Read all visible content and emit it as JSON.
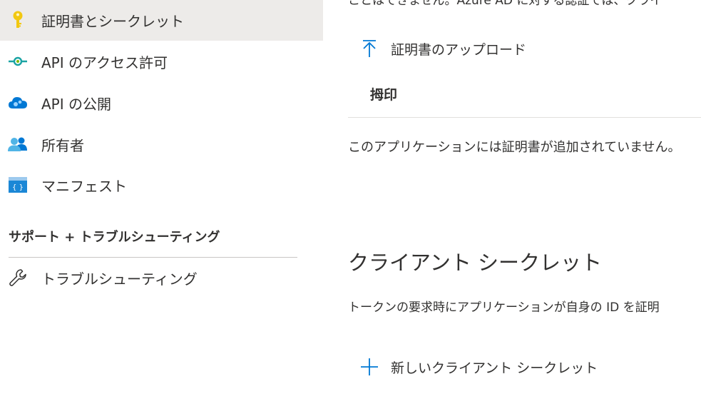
{
  "sidebar": {
    "items": [
      {
        "label": "証明書とシークレット",
        "icon": "key-icon",
        "selected": true
      },
      {
        "label": "API のアクセス許可",
        "icon": "api-permissions-icon"
      },
      {
        "label": "API の公開",
        "icon": "cloud-api-icon"
      },
      {
        "label": "所有者",
        "icon": "users-icon"
      },
      {
        "label": "マニフェスト",
        "icon": "manifest-icon"
      }
    ],
    "support_section": {
      "header": "サポート + トラブルシューティング",
      "items": [
        {
          "label": "トラブルシューティング",
          "icon": "wrench-icon"
        }
      ]
    }
  },
  "main": {
    "clipped_text": "ことはできません。Azure AD に対する認証では、クライ",
    "certificates": {
      "upload_button_label": "証明書のアップロード",
      "column_header": "拇印",
      "empty_message": "このアプリケーションには証明書が追加されていません。"
    },
    "client_secrets": {
      "title": "クライアント シークレット",
      "description": "トークンの要求時にアプリケーションが自身の ID を証明",
      "new_button_label": "新しいクライアント シークレット"
    }
  },
  "colors": {
    "accent": "#0078d4",
    "selected_bg": "#edebe9",
    "text": "#323130",
    "key": "#f2c811"
  }
}
